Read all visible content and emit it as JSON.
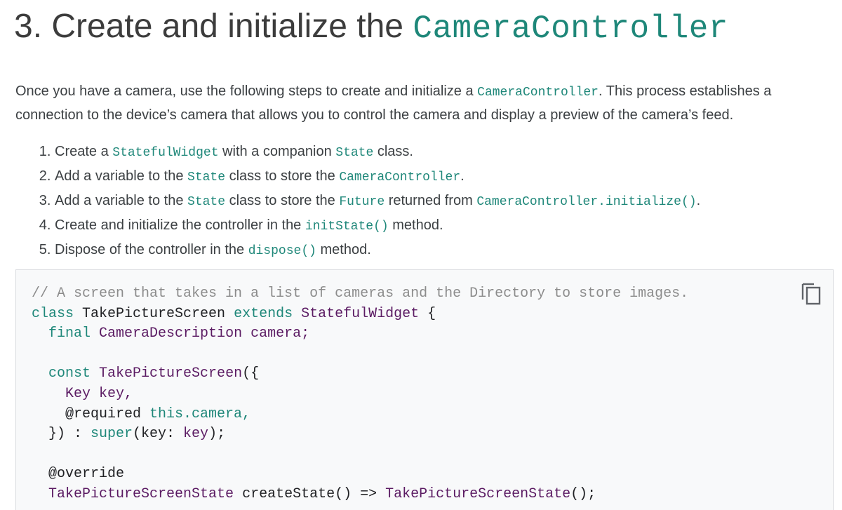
{
  "heading": {
    "prefix": "3. Create and initialize the ",
    "code": "CameraController"
  },
  "intro": {
    "part1": "Once you have a camera, use the following steps to create and initialize a ",
    "code": "CameraController",
    "part2": ". This process establishes a connection to the device’s camera that allows you to control the camera and display a preview of the camera’s feed."
  },
  "steps": [
    {
      "t1": "Create a ",
      "c1": "StatefulWidget",
      "t2": " with a companion ",
      "c2": "State",
      "t3": " class."
    },
    {
      "t1": "Add a variable to the ",
      "c1": "State",
      "t2": " class to store the ",
      "c2": "CameraController",
      "t3": "."
    },
    {
      "t1": "Add a variable to the ",
      "c1": "State",
      "t2": " class to store the ",
      "c2": "Future",
      "t3": " returned from ",
      "c3": "CameraController.initialize()",
      "t4": "."
    },
    {
      "t1": "Create and initialize the controller in the ",
      "c1": "initState()",
      "t2": " method."
    },
    {
      "t1": "Dispose of the controller in the ",
      "c1": "dispose()",
      "t2": " method."
    }
  ],
  "code": {
    "comment": "// A screen that takes in a list of cameras and the Directory to store images.",
    "l2_kw1": "class",
    "l2_name": " TakePictureScreen ",
    "l2_kw2": "extends",
    "l2_type": " StatefulWidget",
    "l2_rest": " {",
    "l3_indent": "  ",
    "l3_kw": "final",
    "l3_type": " CameraDescription",
    "l3_rest": " camera;",
    "l5_indent": "  ",
    "l5_kw": "const",
    "l5_name": " TakePictureScreen",
    "l5_rest": "({",
    "l6_indent": "    ",
    "l6_type": "Key",
    "l6_rest": " key,",
    "l7_text": "    @required ",
    "l7_kw": "this",
    "l7_rest": ".camera,",
    "l8_text": "  }) : ",
    "l8_kw": "super",
    "l8_mid": "(key: ",
    "l8_type": "key",
    "l8_rest": ");",
    "l10_text": "  @override",
    "l11_indent": "  ",
    "l11_type": "TakePictureScreenState",
    "l11_mid": " createState() => ",
    "l11_name": "TakePictureScreenState",
    "l11_rest": "();"
  },
  "icons": {
    "copy": "copy-icon"
  },
  "colors": {
    "code_accent": "#1e8779",
    "code_type": "#5b1b63",
    "code_comment": "#8c8c8c",
    "code_bg": "#f8f9fa"
  }
}
